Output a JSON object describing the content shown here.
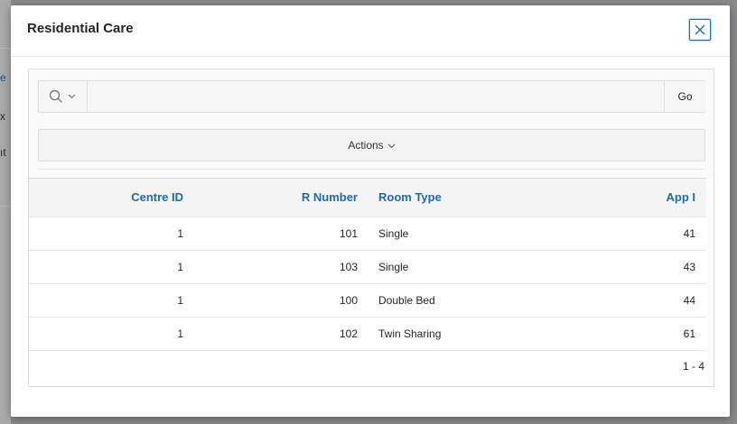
{
  "background": {
    "fragments": [
      "e",
      "x",
      "ıt"
    ]
  },
  "dialog": {
    "title": "Residential Care",
    "close_icon": "close-icon"
  },
  "toolbar": {
    "search_icon": "search-icon",
    "search_value": "",
    "search_placeholder": "",
    "go_label": "Go",
    "actions_label": "Actions"
  },
  "table": {
    "columns": [
      "Centre ID",
      "R Number",
      "Room Type",
      "App I"
    ],
    "rows": [
      [
        "1",
        "101",
        "Single",
        "41"
      ],
      [
        "1",
        "103",
        "Single",
        "43"
      ],
      [
        "1",
        "100",
        "Double Bed",
        "44"
      ],
      [
        "1",
        "102",
        "Twin Sharing",
        "61"
      ]
    ],
    "pagination": "1 - 4"
  },
  "colors": {
    "accent": "#1a6db5",
    "dialog_bg": "#ffffff",
    "overlay": "#8a8a8a"
  }
}
